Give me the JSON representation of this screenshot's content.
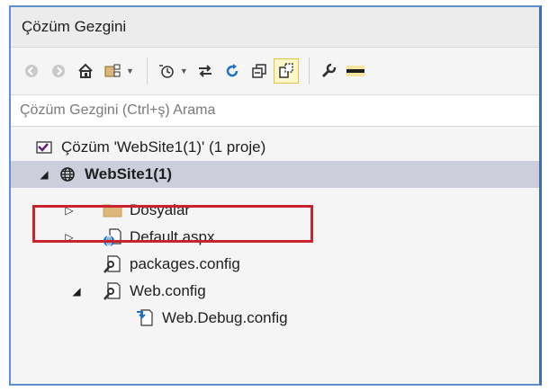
{
  "panel": {
    "title": "Çözüm Gezgini"
  },
  "toolbar": {
    "buttons": [
      {
        "icon": "back-icon"
      },
      {
        "icon": "forward-icon"
      },
      {
        "icon": "home-icon"
      },
      {
        "icon": "switch-views-icon"
      },
      {
        "icon": "pending-changes-icon"
      },
      {
        "icon": "sync-icon"
      },
      {
        "icon": "refresh-icon"
      },
      {
        "icon": "collapse-all-icon"
      },
      {
        "icon": "show-all-files-icon"
      },
      {
        "icon": "properties-icon"
      },
      {
        "icon": "preview-icon"
      }
    ]
  },
  "search": {
    "placeholder": "Çözüm Gezgini (Ctrl+ş) Arama"
  },
  "tree": {
    "solution": "Çözüm 'WebSite1(1)' (1 proje)",
    "project": "WebSite1(1)",
    "items": [
      {
        "label": "Dosyalar",
        "icon": "folder-icon"
      },
      {
        "label": "Default.aspx",
        "icon": "aspx-file-icon"
      },
      {
        "label": "packages.config",
        "icon": "config-file-icon"
      },
      {
        "label": "Web.config",
        "icon": "config-file-icon"
      },
      {
        "label": "Web.Debug.config",
        "icon": "config-transform-icon"
      }
    ]
  },
  "colors": {
    "selection": "#cccedb",
    "highlight": "#c8242f",
    "accent": "#007acc"
  }
}
